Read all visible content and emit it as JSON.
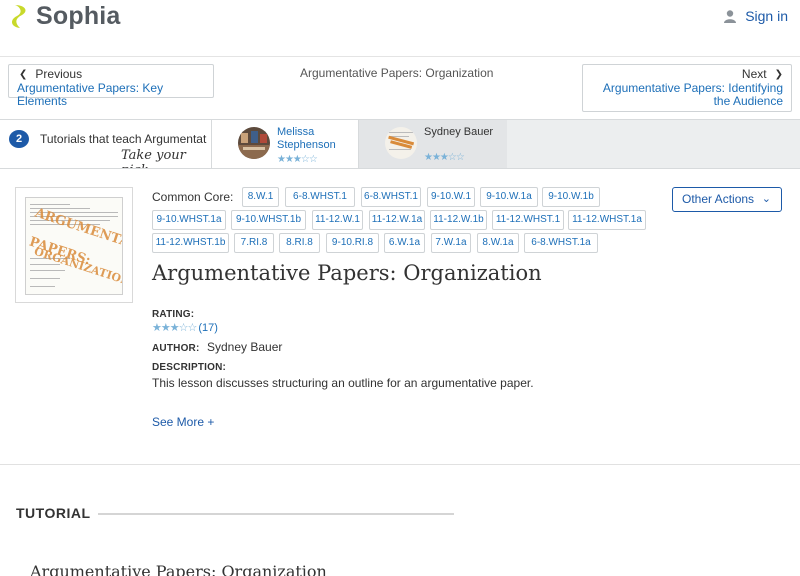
{
  "header": {
    "logo_text": "Sophia",
    "signin_label": "Sign in"
  },
  "nav": {
    "prev_label": "Previous",
    "prev_link": "Argumentative Papers: Key Elements",
    "current_title": "Argumentative Papers: Organization",
    "next_label": "Next",
    "next_link": "Argumentative Papers: Identifying the Audience"
  },
  "tutors": {
    "count": "2",
    "title": "Tutorials that teach Argumentat",
    "pick_label": "Take your pick:",
    "cards": [
      {
        "name": "Melissa Stephenson",
        "stars": "★★★☆☆"
      },
      {
        "name": "Sydney Bauer",
        "stars": "★★★☆☆"
      }
    ]
  },
  "lesson": {
    "thumb_stamp": [
      "ARGUMENTATIVE",
      "PAPERS:",
      "ORGANIZATION"
    ],
    "common_core_label": "Common Core:",
    "tags": [
      "8.W.1",
      "6-8.WHST.1",
      "6-8.WHST.1",
      "9-10.W.1",
      "9-10.W.1a",
      "9-10.W.1b",
      "9-10.WHST.1a",
      "9-10.WHST.1b",
      "11-12.W.1",
      "11-12.W.1a",
      "11-12.W.1b",
      "11-12.WHST.1",
      "11-12.WHST.1a",
      "11-12.WHST.1b",
      "7.RI.8",
      "8.RI.8",
      "9-10.RI.8",
      "6.W.1a",
      "7.W.1a",
      "8.W.1a",
      "6-8.WHST.1a"
    ],
    "other_actions_label": "Other Actions",
    "title": "Argumentative Papers: Organization",
    "rating_label": "RATING:",
    "rating_stars": "★★★☆☆",
    "rating_count": "(17)",
    "author_label": "AUTHOR:",
    "author": "Sydney Bauer",
    "description_label": "DESCRIPTION:",
    "description": "This lesson discusses structuring an outline for an argumentative paper.",
    "see_more_label": "See More +"
  },
  "tutorial": {
    "heading": "TUTORIAL",
    "title": "Argumentative Papers: Organization"
  },
  "colors": {
    "brand_blue": "#1d5aa8",
    "link_blue": "#1d6fb8",
    "logo_green": "#c8d92b"
  },
  "icons": [
    "sophia-logo-icon",
    "user-icon",
    "chevron-left-icon",
    "chevron-right-icon",
    "chevron-down-icon",
    "star-icon"
  ]
}
